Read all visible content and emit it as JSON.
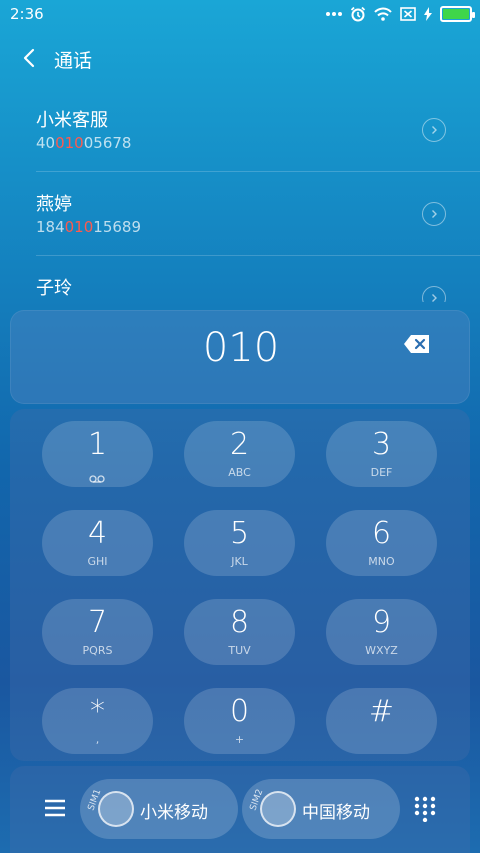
{
  "status_bar": {
    "time": "2:36",
    "battery_level": 1.0
  },
  "header": {
    "title": "通话"
  },
  "contacts": [
    {
      "name": "小米客服",
      "number_pre": "40",
      "number_match": "010",
      "number_post": "05678"
    },
    {
      "name": "燕婷",
      "number_pre": "184",
      "number_match": "010",
      "number_post": "15689"
    },
    {
      "name": "子玲",
      "number_pre": "",
      "number_match": "",
      "number_post": ""
    }
  ],
  "dialer": {
    "number": "010"
  },
  "keypad": [
    {
      "digit": "1",
      "sub": ""
    },
    {
      "digit": "2",
      "sub": "ABC"
    },
    {
      "digit": "3",
      "sub": "DEF"
    },
    {
      "digit": "4",
      "sub": "GHI"
    },
    {
      "digit": "5",
      "sub": "JKL"
    },
    {
      "digit": "6",
      "sub": "MNO"
    },
    {
      "digit": "7",
      "sub": "PQRS"
    },
    {
      "digit": "8",
      "sub": "TUV"
    },
    {
      "digit": "9",
      "sub": "WXYZ"
    },
    {
      "digit": "*",
      "sub": ","
    },
    {
      "digit": "0",
      "sub": "+"
    },
    {
      "digit": "#",
      "sub": ""
    }
  ],
  "sims": [
    {
      "tag": "SIM1",
      "label": "小米移动"
    },
    {
      "tag": "SIM2",
      "label": "中国移动"
    }
  ],
  "colors": {
    "match_highlight": "#ff5a4e",
    "battery": "#3fd64a"
  }
}
